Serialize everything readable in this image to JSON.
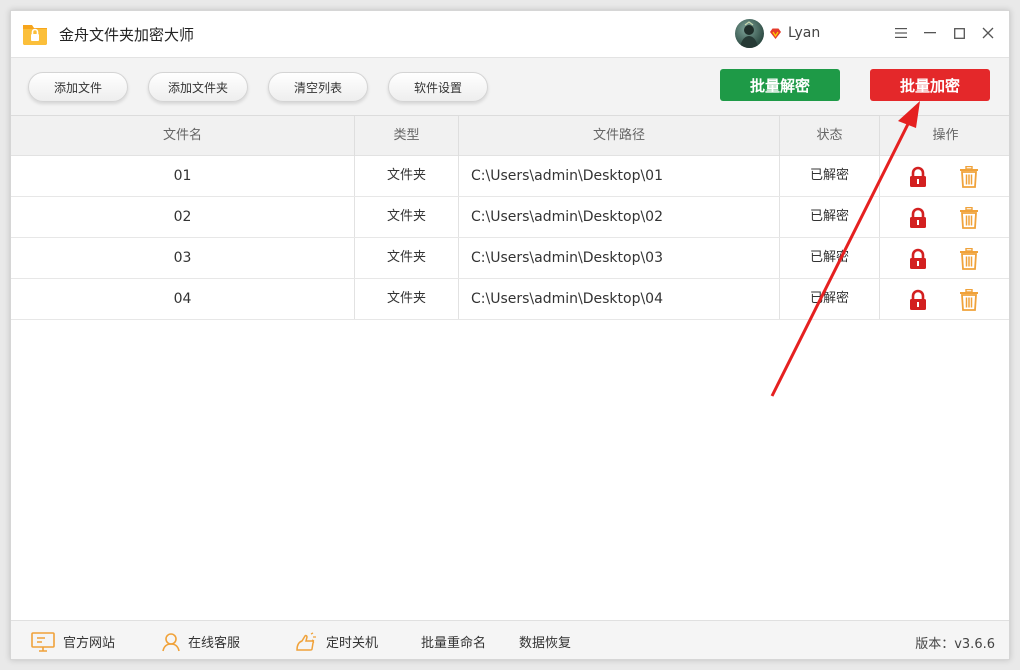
{
  "app": {
    "title": "金舟文件夹加密大师"
  },
  "user": {
    "name": "Lyan"
  },
  "toolbar": {
    "add_file": "添加文件",
    "add_folder": "添加文件夹",
    "clear_list": "清空列表",
    "settings": "软件设置",
    "batch_decrypt": "批量解密",
    "batch_encrypt": "批量加密"
  },
  "table": {
    "headers": {
      "name": "文件名",
      "type": "类型",
      "path": "文件路径",
      "state": "状态",
      "op": "操作"
    },
    "rows": [
      {
        "name": "01",
        "type": "文件夹",
        "path": "C:\\Users\\admin\\Desktop\\01",
        "state": "已解密"
      },
      {
        "name": "02",
        "type": "文件夹",
        "path": "C:\\Users\\admin\\Desktop\\02",
        "state": "已解密"
      },
      {
        "name": "03",
        "type": "文件夹",
        "path": "C:\\Users\\admin\\Desktop\\03",
        "state": "已解密"
      },
      {
        "name": "04",
        "type": "文件夹",
        "path": "C:\\Users\\admin\\Desktop\\04",
        "state": "已解密"
      }
    ]
  },
  "footer": {
    "website": "官方网站",
    "support": "在线客服",
    "shutdown": "定时关机",
    "rename": "批量重命名",
    "recovery": "数据恢复",
    "version": "版本：v3.6.6"
  },
  "colors": {
    "green": "#1e9a47",
    "red": "#e4282a",
    "lock": "#d32020",
    "trash": "#f0a23a",
    "arrow": "#e52020"
  },
  "icons": {
    "logo": "folder-lock-logo-icon",
    "vip": "vip-diamond-icon",
    "menu": "menu-icon",
    "minimize": "minimize-icon",
    "maximize": "maximize-icon",
    "close": "close-icon",
    "lock": "lock-icon",
    "trash": "trash-icon",
    "website": "monitor-icon",
    "support": "person-icon",
    "shutdown": "hand-icon"
  }
}
